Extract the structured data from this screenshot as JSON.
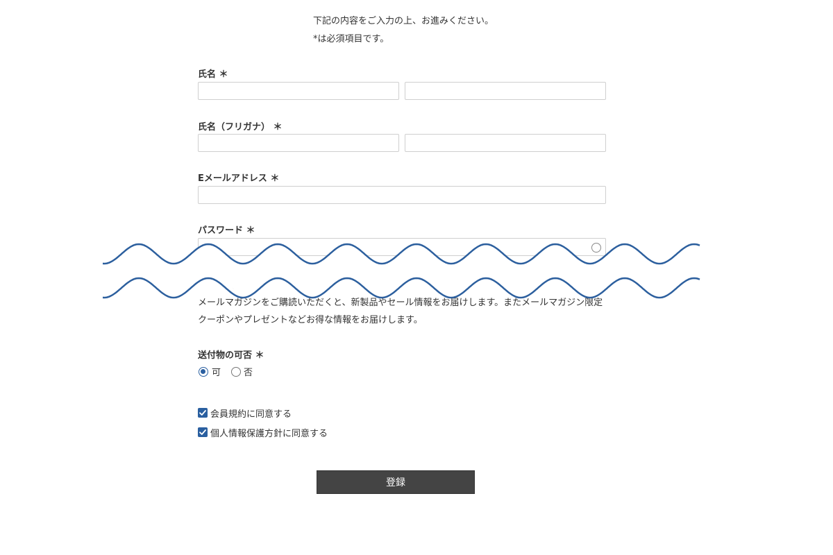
{
  "intro": {
    "line1": "下記の内容をご入力の上、お進みください。",
    "line2": "*は必須項目です。"
  },
  "fields": {
    "name": {
      "label": "氏名 ＊",
      "last_value": "",
      "first_value": ""
    },
    "name_kana": {
      "label": "氏名（フリガナ） ＊",
      "last_value": "",
      "first_value": ""
    },
    "email": {
      "label": "Eメールアドレス ＊",
      "value": ""
    },
    "password": {
      "label": "パスワード ＊",
      "value": "",
      "toggle_icon": "eye-icon"
    }
  },
  "newsletter": {
    "option_no_partial": "否",
    "description_line1": "メールマガジンをご購読いただくと、新製品やセール情報をお届けします。またメールマガジン限定",
    "description_line2": "クーポンやプレゼントなどお得な情報をお届けします。"
  },
  "shipment": {
    "label": "送付物の可否 ＊",
    "options": [
      {
        "label": "可",
        "checked": true
      },
      {
        "label": "否",
        "checked": false
      }
    ]
  },
  "agreements": [
    {
      "label": "会員規約に同意する",
      "checked": true
    },
    {
      "label": "個人情報保護方針に同意する",
      "checked": true
    }
  ],
  "submit_label": "登録",
  "colors": {
    "accent": "#2a5fa0",
    "wave": "#2c5f9e",
    "button_bg": "#444444",
    "text": "#333333",
    "border": "#cfcfcf"
  }
}
